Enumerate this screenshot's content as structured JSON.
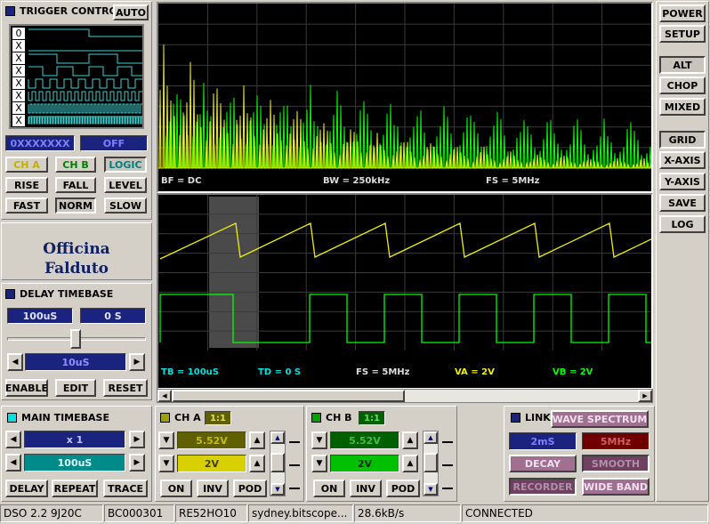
{
  "trigger": {
    "title": "TRIGGER CONTROL",
    "auto": "AUTO",
    "bits": [
      "0",
      "X",
      "X",
      "X",
      "X",
      "X",
      "X",
      "X"
    ],
    "mask": "0XXXXXXX",
    "state": "OFF",
    "ch_a": "CH A",
    "ch_b": "CH B",
    "logic": "LOGIC",
    "rise": "RISE",
    "fall": "FALL",
    "level": "LEVEL",
    "fast": "FAST",
    "norm": "NORM",
    "slow": "SLOW"
  },
  "logo": {
    "line1": "Officina",
    "line2": "Falduto"
  },
  "delay": {
    "title": "DELAY TIMEBASE",
    "time": "100uS",
    "offset": "0 S",
    "step": "10uS",
    "enable": "ENABLE",
    "edit": "EDIT",
    "reset": "RESET"
  },
  "main_tb": {
    "title": "MAIN TIMEBASE",
    "mult": "x 1",
    "time": "100uS",
    "delay": "DELAY",
    "repeat": "REPEAT",
    "trace": "TRACE"
  },
  "spectrum": {
    "bf": "BF = DC",
    "bw": "BW = 250kHz",
    "fs": "FS = 5MHz"
  },
  "wave": {
    "tb": "TB = 100uS",
    "td": "TD = 0 S",
    "fs": "FS = 5MHz",
    "va": "VA = 2V",
    "vb": "VB = 2V"
  },
  "cha": {
    "title": "CH A",
    "ratio": "1:1",
    "offset": "5.52V",
    "volts": "2V",
    "on": "ON",
    "inv": "INV",
    "pod": "POD"
  },
  "chb": {
    "title": "CH B",
    "ratio": "1:1",
    "offset": "5.52V",
    "volts": "2V",
    "on": "ON",
    "inv": "INV",
    "pod": "POD"
  },
  "link": {
    "title": "LINK",
    "wave_spectrum": "WAVE SPECTRUM",
    "time": "2mS",
    "freq": "5MHz",
    "decay": "DECAY",
    "smooth": "SMOOTH",
    "recorder": "RECORDER",
    "wide_band": "WIDE BAND"
  },
  "right": {
    "power": "POWER",
    "setup": "SETUP",
    "alt": "ALT",
    "chop": "CHOP",
    "mixed": "MIXED",
    "grid": "GRID",
    "xaxis": "X-AXIS",
    "yaxis": "Y-AXIS",
    "save": "SAVE",
    "log": "LOG"
  },
  "status": {
    "version": "DSO 2.2 9J20C",
    "id": "BC000301",
    "rev": "RE52HO10",
    "host": "sydney.bitscope...",
    "rate": "28.6kB/s",
    "conn": "CONNECTED"
  },
  "colors": {
    "cha": "#f0f000",
    "chb": "#00ff00",
    "display_bg": "#000000",
    "field_bg": "#1a237e",
    "cyan": "#00e0e0"
  }
}
